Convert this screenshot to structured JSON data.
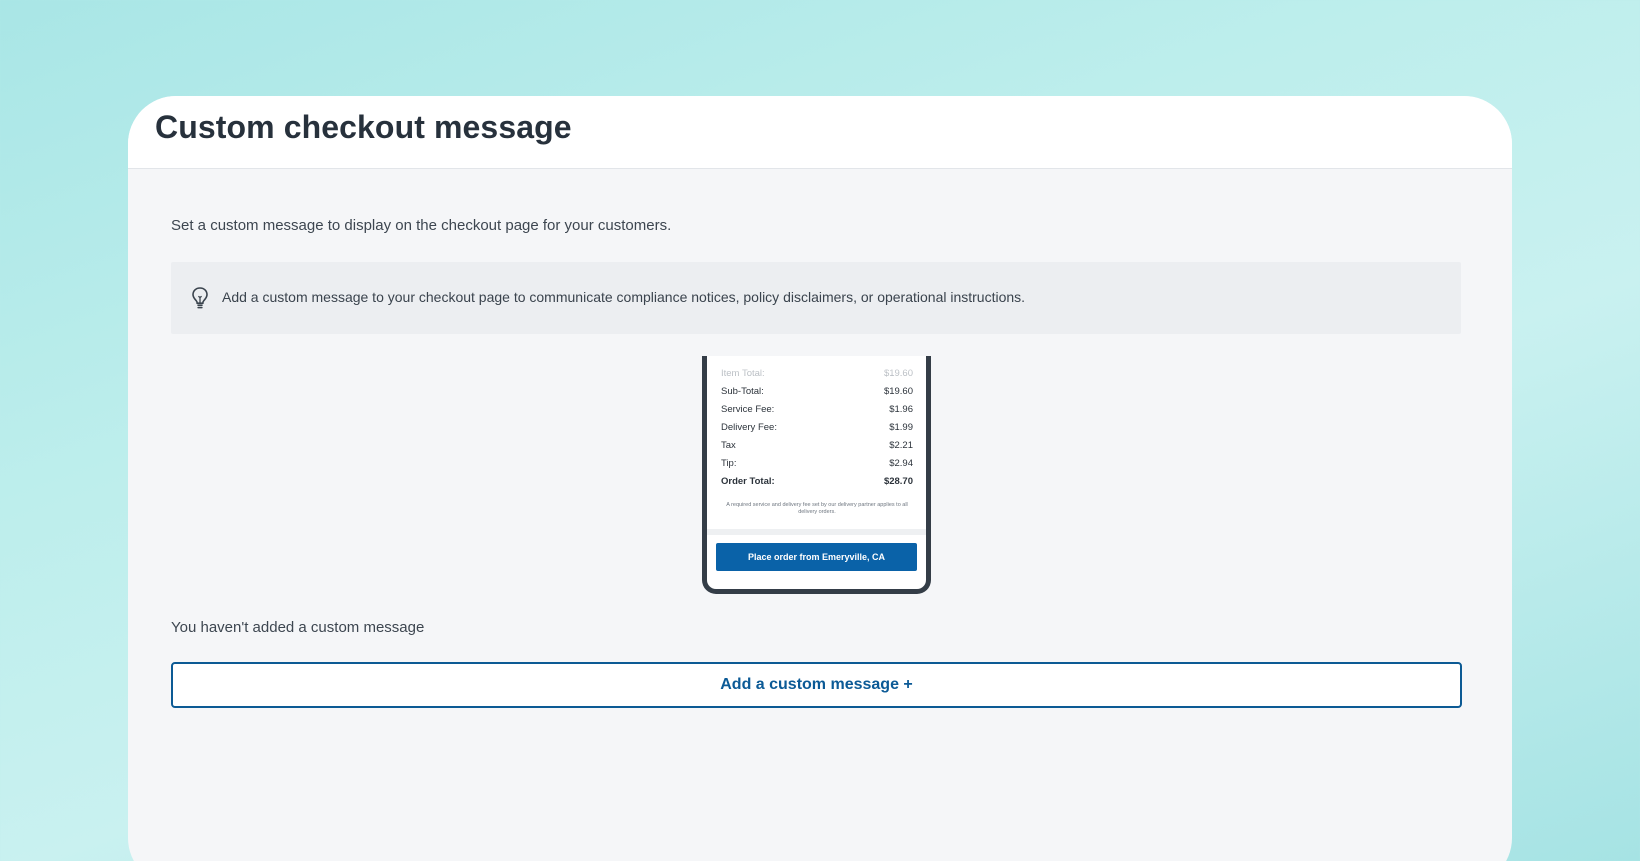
{
  "page": {
    "title": "Custom checkout message",
    "description": "Set a custom message to display on the checkout page for your customers."
  },
  "tip": {
    "icon": "lightbulb-icon",
    "text": "Add a custom message to your checkout page to communicate compliance notices, policy disclaimers, or operational instructions."
  },
  "preview": {
    "rows": [
      {
        "label": "Item Total:",
        "value": "$19.60"
      },
      {
        "label": "Sub-Total:",
        "value": "$19.60"
      },
      {
        "label": "Service Fee:",
        "value": "$1.96"
      },
      {
        "label": "Delivery Fee:",
        "value": "$1.99"
      },
      {
        "label": "Tax",
        "value": "$2.21"
      },
      {
        "label": "Tip:",
        "value": "$2.94"
      },
      {
        "label": "Order Total:",
        "value": "$28.70"
      }
    ],
    "fineprint": "A required service and delivery fee set by our delivery partner applies to all delivery orders.",
    "button_label": "Place order from Emeryville, CA",
    "accent_color": "#0a62a8"
  },
  "empty_state": "You haven't added a custom message",
  "add_button_label": "Add a custom message +",
  "colors": {
    "primary": "#0b5a96",
    "background": "#f5f6f8"
  }
}
